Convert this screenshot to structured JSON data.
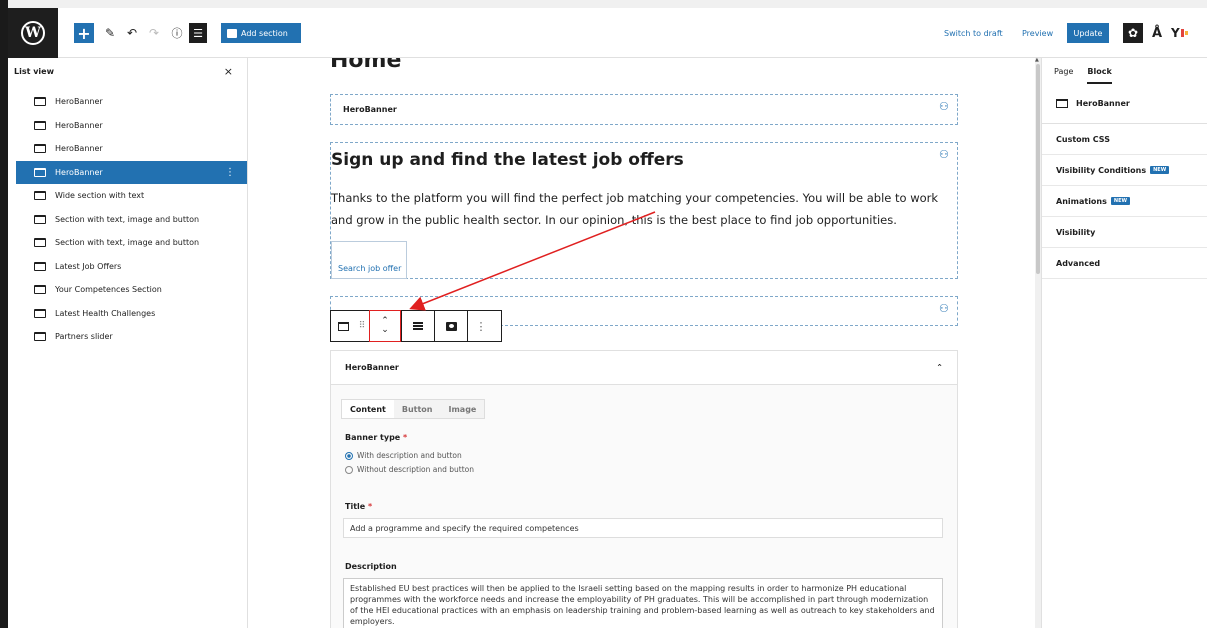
{
  "toolbar": {
    "add_section_label": "Add section",
    "switch_to_draft": "Switch to draft",
    "preview": "Preview",
    "update": "Update"
  },
  "list_view": {
    "title": "List view",
    "close": "×",
    "items": [
      {
        "label": "HeroBanner"
      },
      {
        "label": "HeroBanner"
      },
      {
        "label": "HeroBanner"
      },
      {
        "label": "HeroBanner"
      },
      {
        "label": "Wide section with text"
      },
      {
        "label": "Section with text, image and button"
      },
      {
        "label": "Section with text, image and button"
      },
      {
        "label": "Latest Job Offers"
      },
      {
        "label": "Your Competences Section"
      },
      {
        "label": "Latest Health Challenges"
      },
      {
        "label": "Partners slider"
      }
    ],
    "selected_index": 3
  },
  "canvas": {
    "page_title": "Home",
    "block1_label": "HeroBanner",
    "hero_heading": "Sign up and find the latest job offers",
    "hero_paragraph": "Thanks to the platform you will find the perfect job matching your competencies. You will be able to work and grow in the public health sector. In our opinion, this is the best place to find job opportunities.",
    "hero_button": "Search job offer"
  },
  "panel": {
    "title": "HeroBanner",
    "tabs": [
      "Content",
      "Button",
      "Image"
    ],
    "active_tab": "Content",
    "banner_type_label": "Banner type",
    "radio_options": [
      "With description and button",
      "Without description and button"
    ],
    "selected_radio": 0,
    "title_label": "Title",
    "title_value": "Add a programme and specify the required competences",
    "description_label": "Description",
    "description_value": "Established EU best practices will then be applied to the Israeli setting based on the mapping results in order to harmonize PH educational programmes with the workforce needs and increase the employability of PH graduates. This will be accomplished in part through modernization of the HEI educational practices with an emphasis on leadership training and problem-based learning as well as outreach to key stakeholders and employers."
  },
  "settings": {
    "tabs": [
      "Page",
      "Block"
    ],
    "active_tab": "Block",
    "block_name": "HeroBanner",
    "rows": [
      {
        "label": "Custom CSS",
        "badge": ""
      },
      {
        "label": "Visibility Conditions",
        "badge": "NEW"
      },
      {
        "label": "Animations",
        "badge": "NEW"
      },
      {
        "label": "Visibility",
        "badge": ""
      },
      {
        "label": "Advanced",
        "badge": ""
      }
    ]
  },
  "colors": {
    "accent": "#2271b1",
    "annotation": "#e02020",
    "dark": "#1e1e1e"
  }
}
